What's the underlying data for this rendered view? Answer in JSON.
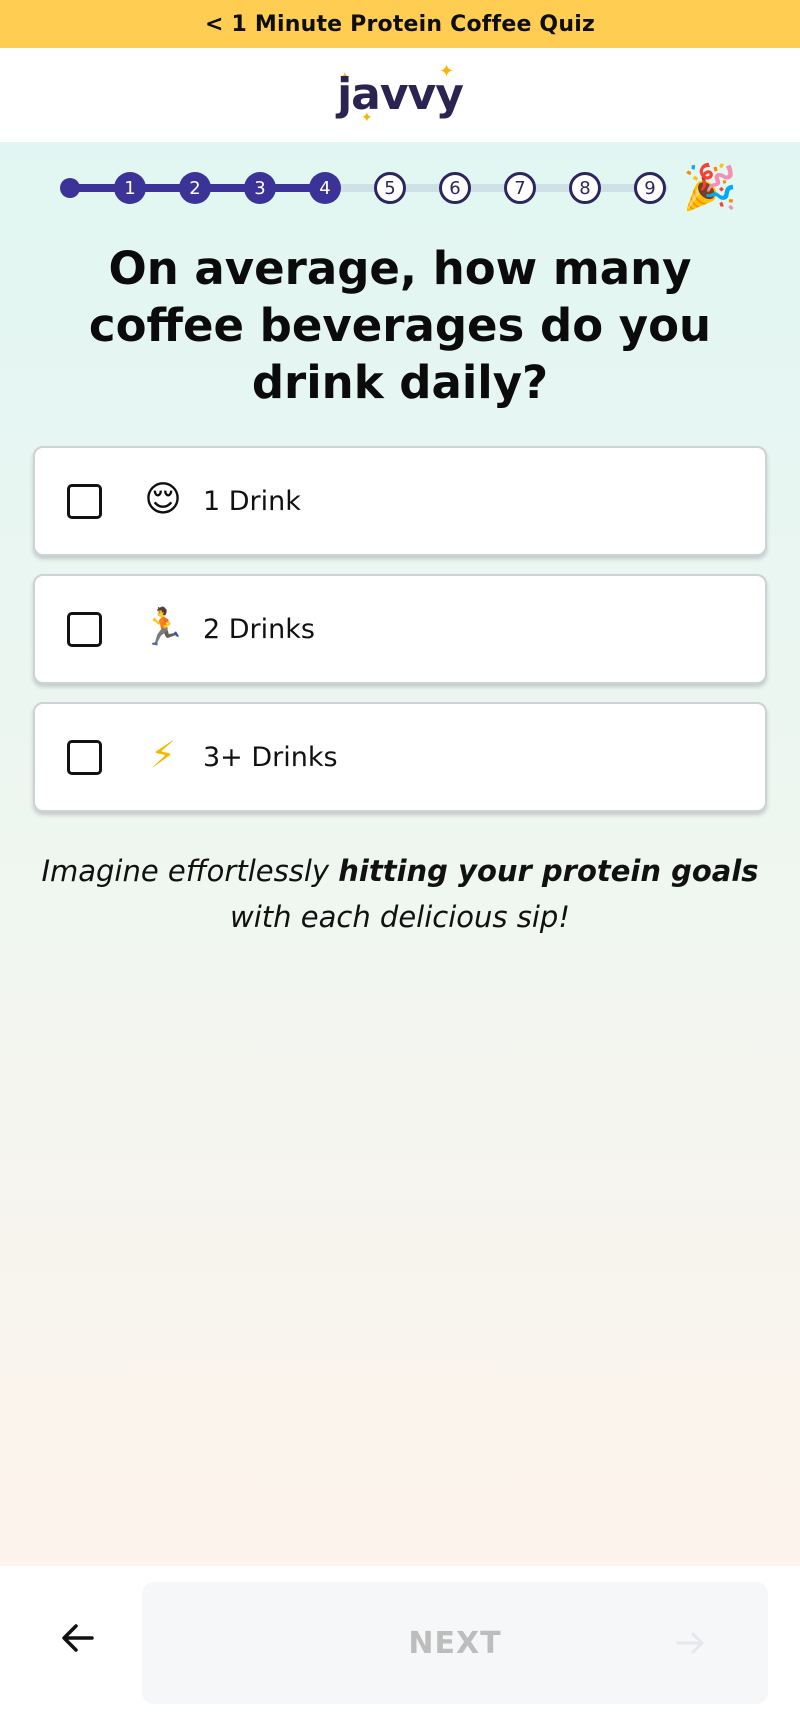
{
  "banner": {
    "text": "< 1 Minute Protein Coffee Quiz"
  },
  "header": {
    "logo_text": "javvy"
  },
  "progress": {
    "completed_steps": 4,
    "total_steps": 9,
    "steps": [
      "1",
      "2",
      "3",
      "4",
      "5",
      "6",
      "7",
      "8",
      "9"
    ],
    "final_icon": "party-popper-icon"
  },
  "question": {
    "text": "On average, how many coffee beverages do you drink daily?"
  },
  "options": [
    {
      "label": "1 Drink",
      "icon": "relieved-face-icon",
      "emoji": "😌",
      "checked": false
    },
    {
      "label": "2 Drinks",
      "icon": "running-person-icon",
      "emoji": "🏃",
      "checked": false
    },
    {
      "label": "3+ Drinks",
      "icon": "lightning-icon",
      "emoji": "⚡",
      "checked": false
    }
  ],
  "tagline": {
    "part1": "Imagine effortlessly ",
    "bold": "hitting your protein goals",
    "part2": " with each delicious sip!"
  },
  "footer": {
    "back_icon": "arrow-left-icon",
    "next_label": "NEXT",
    "next_icon": "arrow-right-icon",
    "next_enabled": false
  },
  "colors": {
    "banner": "#ffcd52",
    "accent": "#3b3398",
    "logo": "#2b2350",
    "sparkle": "#f5b800"
  }
}
